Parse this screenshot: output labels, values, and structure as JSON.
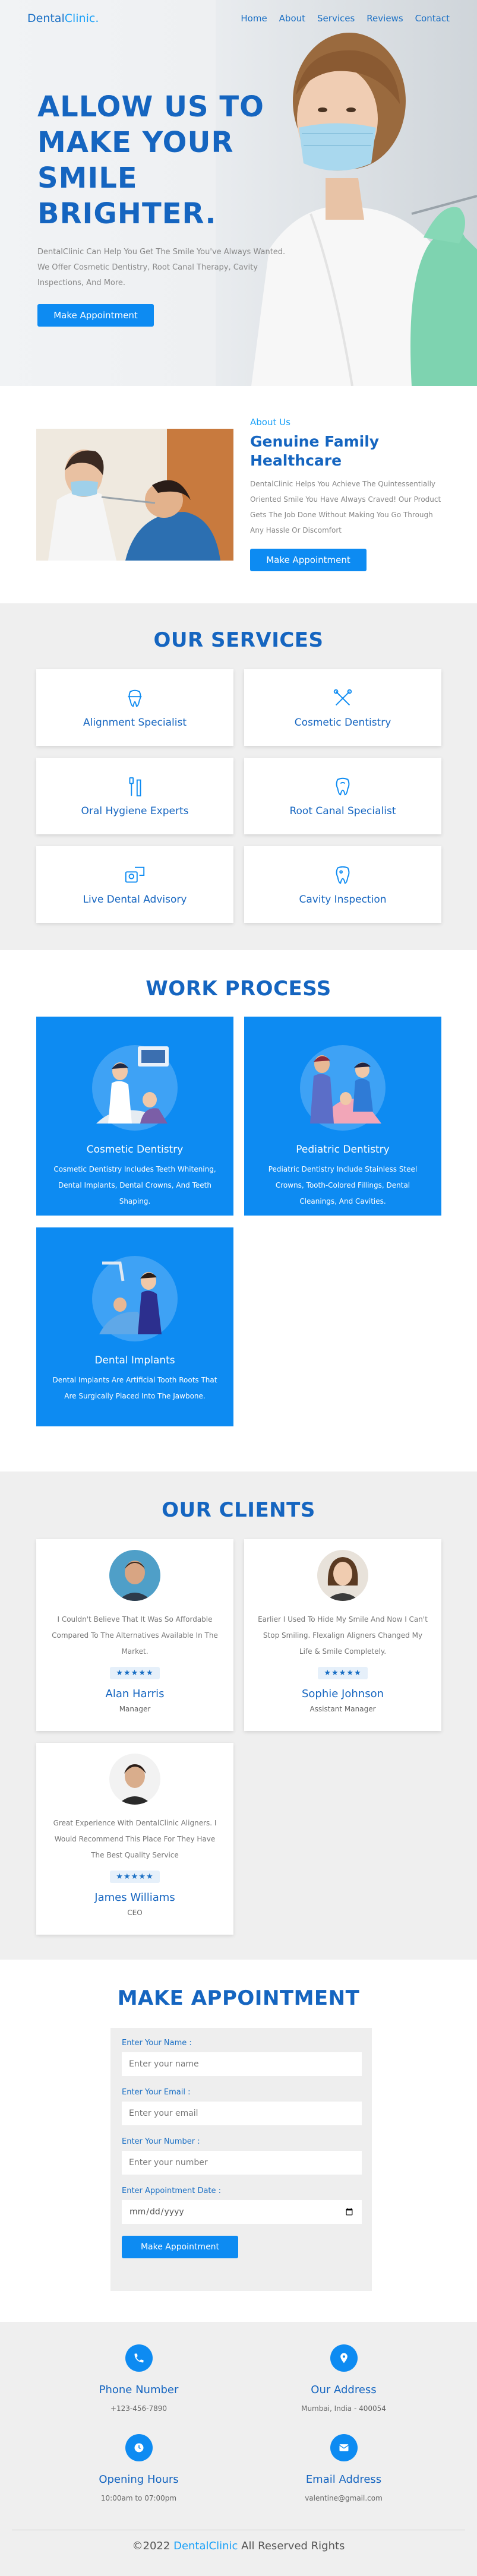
{
  "header": {
    "logo_main": "Dental",
    "logo_accent": "Clinic.",
    "nav": [
      "Home",
      "About",
      "Services",
      "Reviews",
      "Contact"
    ]
  },
  "hero": {
    "title": "ALLOW US TO MAKE YOUR SMILE BRIGHTER.",
    "description": "DentalClinic Can Help You Get The Smile You've Always Wanted. We Offer Cosmetic Dentistry, Root Canal Therapy, Cavity Inspections, And More.",
    "button": "Make Appointment"
  },
  "about": {
    "tag": "About Us",
    "title": "Genuine Family Healthcare",
    "description": "DentalClinic Helps You Achieve The Quintessentially Oriented Smile You Have Always Craved! Our Product Gets The Job Done Without Making You Go Through Any Hassle Or Discomfort",
    "button": "Make Appointment"
  },
  "services": {
    "title": "OUR SERVICES",
    "items": [
      {
        "name": "Alignment Specialist",
        "icon": "tooth-alignment-icon"
      },
      {
        "name": "Cosmetic Dentistry",
        "icon": "dental-tools-icon"
      },
      {
        "name": "Oral Hygiene Experts",
        "icon": "toothbrush-icon"
      },
      {
        "name": "Root Canal Specialist",
        "icon": "tooth-root-icon"
      },
      {
        "name": "Live Dental Advisory",
        "icon": "dental-advisory-icon"
      },
      {
        "name": "Cavity Inspection",
        "icon": "cavity-tooth-icon"
      }
    ]
  },
  "work": {
    "title": "WORK PROCESS",
    "items": [
      {
        "name": "Cosmetic Dentistry",
        "desc": "Cosmetic Dentistry Includes Teeth Whitening, Dental Implants, Dental Crowns, And Teeth Shaping."
      },
      {
        "name": "Pediatric Dentistry",
        "desc": "Pediatric Dentistry Include Stainless Steel Crowns, Tooth-Colored Fillings, Dental Cleanings, And Cavities."
      },
      {
        "name": "Dental Implants",
        "desc": "Dental Implants Are Artificial Tooth Roots That Are Surgically Placed Into The Jawbone."
      }
    ]
  },
  "clients": {
    "title": "OUR CLIENTS",
    "items": [
      {
        "quote": "I Couldn't Believe That It Was So Affordable Compared To The Alternatives Available In The Market.",
        "rating": 5,
        "name": "Alan Harris",
        "role": "Manager"
      },
      {
        "quote": "Earlier I Used To Hide My Smile And Now I Can't Stop Smiling. Flexalign Aligners Changed My Life & Smile Completely.",
        "rating": 5,
        "name": "Sophie Johnson",
        "role": "Assistant Manager"
      },
      {
        "quote": "Great Experience With DentalClinic Aligners. I Would Recommend This Place For They Have The Best Quality Service",
        "rating": 5,
        "name": "James Williams",
        "role": "CEO"
      }
    ]
  },
  "appointment": {
    "title": "MAKE APPOINTMENT",
    "name_label": "Enter Your Name :",
    "name_placeholder": "Enter your name",
    "email_label": "Enter Your Email :",
    "email_placeholder": "Enter your email",
    "number_label": "Enter Your Number :",
    "number_placeholder": "Enter your number",
    "date_label": "Enter Appointment Date :",
    "button": "Make Appointment"
  },
  "footer": {
    "contacts": [
      {
        "title": "Phone Number",
        "value": "+123-456-7890",
        "icon": "phone-icon"
      },
      {
        "title": "Our Address",
        "value": "Mumbai, India - 400054",
        "icon": "map-marker-icon"
      },
      {
        "title": "Opening Hours",
        "value": "10:00am to 07:00pm",
        "icon": "clock-icon"
      },
      {
        "title": "Email Address",
        "value": "valentine@gmail.com",
        "icon": "envelope-icon"
      }
    ],
    "copyright_prefix": "©2022",
    "copyright_brand": "DentalClinic",
    "copyright_suffix": "All Reserved Rights"
  },
  "colors": {
    "primary": "#1565c0",
    "accent": "#0d8bf2",
    "light_bg": "#efefef"
  }
}
